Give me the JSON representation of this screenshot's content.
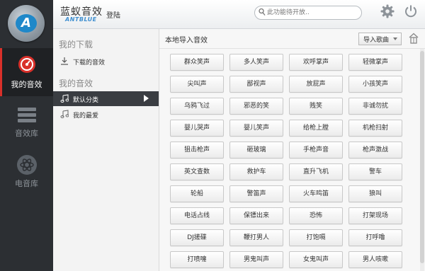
{
  "nav": {
    "items": [
      {
        "label": "我的音效",
        "icon": "speedometer-icon",
        "active": true
      },
      {
        "label": "音效库",
        "icon": "list-icon",
        "active": false
      },
      {
        "label": "电音库",
        "icon": "atom-icon",
        "active": false
      }
    ]
  },
  "header": {
    "brand_name": "蓝蚁音效",
    "brand_sub": "ANTBLUE",
    "login_label": "登陆",
    "search_placeholder": "此功能待开放..",
    "icons": [
      "gear-icon",
      "power-icon"
    ]
  },
  "categories": {
    "section_downloads": "我的下载",
    "downloaded": "下载的音效",
    "section_effects": "我的音效",
    "default_category": "默认分类",
    "favorites": "我的最爱"
  },
  "main": {
    "title": "本地导入音效",
    "import_label": "导入歌曲",
    "buttons": [
      "群众笑声",
      "多人笑声",
      "欢呼掌声",
      "轻微掌声",
      "尖叫声",
      "鄙视声",
      "放屁声",
      "小孩笑声",
      "乌鸦飞过",
      "邪恶的笑",
      "贱笑",
      "非诚勿扰",
      "婴儿哭声",
      "婴儿笑声",
      "给枪上膛",
      "机枪扫射",
      "狙击枪声",
      "砸玻璃",
      "手枪声音",
      "枪声激战",
      "英文查数",
      "救护车",
      "直升飞机",
      "警车",
      "轮船",
      "警笛声",
      "火车鸣笛",
      "狼叫",
      "电话占线",
      "保镖出来",
      "恐怖",
      "打架现场",
      "DJ搓碟",
      "鞭打男人",
      "打饱嗝",
      "打呼噜",
      "打喷嚏",
      "男鬼叫声",
      "女鬼叫声",
      "男人咳嗽"
    ]
  },
  "colors": {
    "accent_red": "#d9302a",
    "brand_blue": "#3f8fd0",
    "nav_bg": "#2c2f33"
  }
}
